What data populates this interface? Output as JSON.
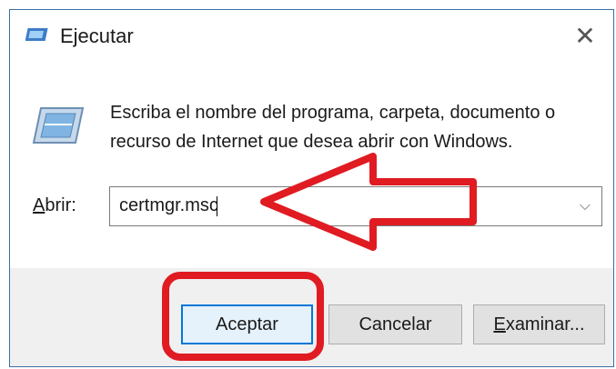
{
  "window": {
    "title": "Ejecutar",
    "close_glyph": "✕"
  },
  "body": {
    "description": "Escriba el nombre del programa, carpeta, documento o recurso de Internet que desea abrir con Windows.",
    "open_label_mnemonic": "A",
    "open_label_rest": "brir:",
    "input_value": "certmgr.msc",
    "dropdown_glyph": "⌵"
  },
  "buttons": {
    "ok": "Aceptar",
    "cancel": "Cancelar",
    "browse_mnemonic": "E",
    "browse_rest": "xaminar..."
  },
  "colors": {
    "annotation_red": "#e01b22",
    "window_border": "#3a6fa8",
    "focus_blue": "#0078d7"
  }
}
